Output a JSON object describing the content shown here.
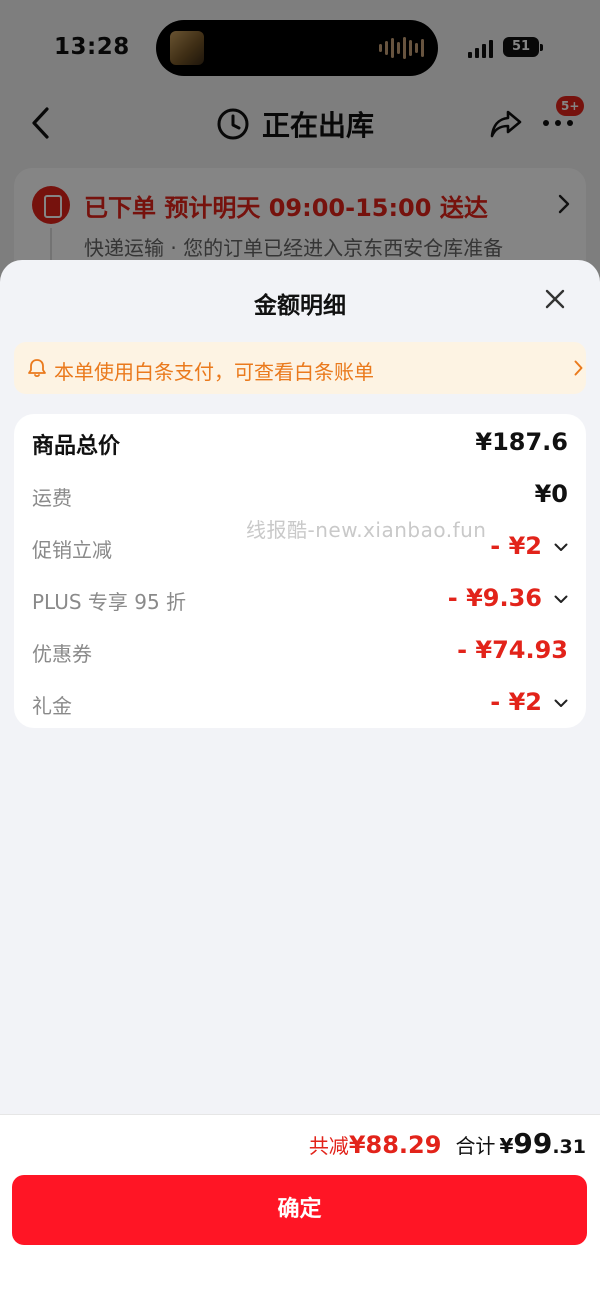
{
  "status_bar": {
    "time": "13:28",
    "battery": "51"
  },
  "nav": {
    "title": "正在出库",
    "badge": "5+"
  },
  "order": {
    "status": "已下单 预计明天 09:00-15:00 送达",
    "subtitle": "快递运输 · 您的订单已经进入京东西安仓库准备"
  },
  "sheet": {
    "title": "金额明细",
    "notice": "本单使用白条支付，可查看白条账单",
    "rows": [
      {
        "label": "商品总价",
        "value": "¥187.6"
      },
      {
        "label": "运费",
        "value": "¥0"
      },
      {
        "label": "促销立减",
        "value": "- ¥2"
      },
      {
        "label": "PLUS 专享 95 折",
        "value": "- ¥9.36"
      },
      {
        "label": "优惠券",
        "value": "- ¥74.93"
      },
      {
        "label": "礼金",
        "value": "- ¥2"
      }
    ],
    "watermark": "线报酷-new.xianbao.fun"
  },
  "footer": {
    "saved_label": "共减",
    "saved_amount": "¥88.29",
    "total_label": "合计",
    "total_currency": "¥",
    "total_int": "99",
    "total_dec": ".31",
    "confirm": "确定"
  },
  "colors": {
    "accent": "#e2231a",
    "button": "#ff1525",
    "notice_text": "#ea7a1d",
    "notice_bg": "#fdf3e3"
  }
}
